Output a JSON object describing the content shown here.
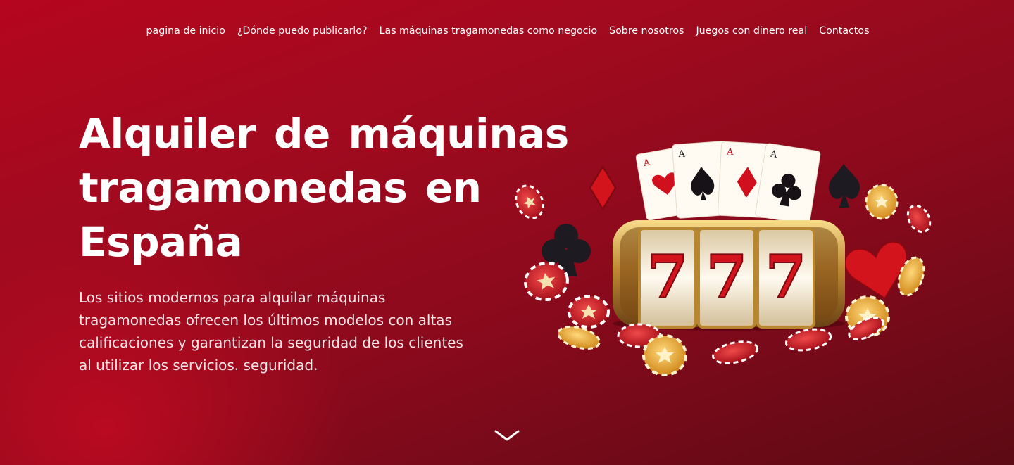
{
  "nav": {
    "items": [
      {
        "label": "pagina de inicio"
      },
      {
        "label": "¿Dónde puedo publicarlo?"
      },
      {
        "label": "Las máquinas tragamonedas como negocio"
      },
      {
        "label": "Sobre nosotros"
      },
      {
        "label": "Juegos con dinero real"
      },
      {
        "label": "Contactos"
      }
    ]
  },
  "hero": {
    "title_lines": [
      "Alquiler de máquinas",
      "tragamonedas en",
      "España"
    ],
    "description_lines": [
      "Los sitios modernos para alquilar máquinas",
      "tragamonedas ofrecen los últimos modelos con altas",
      "calificaciones y garantizan la seguridad de los clientes",
      "al utilizar los servicios.  seguridad."
    ],
    "slot_digits": [
      "7",
      "7",
      "7"
    ],
    "card_ranks": [
      "A",
      "A",
      "A",
      "A"
    ]
  },
  "icons": {
    "scroll": "chevron-down-icon",
    "art": "slot-machine-illustration"
  },
  "colors": {
    "background_start": "#b5061e",
    "background_end": "#5c0a14",
    "text": "#ffffff",
    "gold": "#d9a441",
    "seven_red": "#d4141c"
  }
}
